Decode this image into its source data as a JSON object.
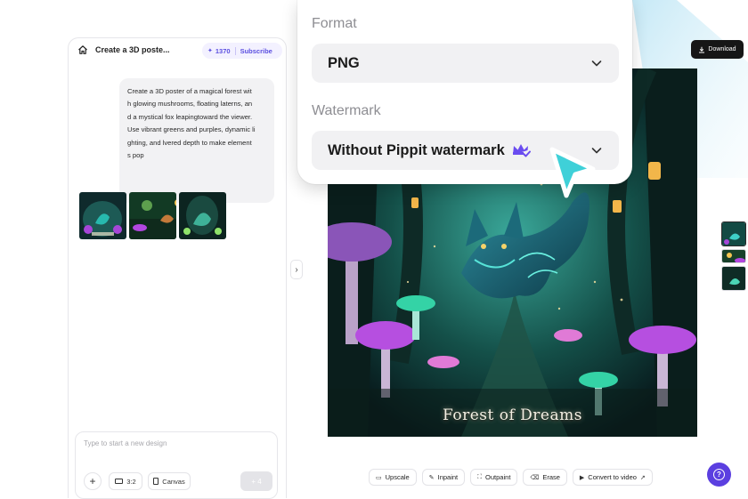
{
  "chat": {
    "title": "Create a 3D poste...",
    "credits": "1370",
    "subscribe": "Subscribe",
    "prompt_lines": [
      "Create a 3D poster of a magical forest wit",
      "h glowing mushrooms, floating laterns, an",
      "d a mystical fox leapingtoward the viewer.",
      "Use vibrant greens and purples, dynamic li",
      "ghting, and lvered depth to make element",
      "s pop"
    ],
    "input_placeholder": "Type to start a new design",
    "ratio_label": "3:2",
    "canvas_label": "Canvas",
    "send_label": "+ 4"
  },
  "canvas": {
    "download_label": "Download",
    "poster_title": "Forest of Dreams",
    "tools": [
      {
        "label": "Upscale",
        "icon": "upscale-icon",
        "glyph": "▭"
      },
      {
        "label": "Inpaint",
        "icon": "brush-icon",
        "glyph": "✎"
      },
      {
        "label": "Outpaint",
        "icon": "expand-icon",
        "glyph": "⛶"
      },
      {
        "label": "Erase",
        "icon": "eraser-icon",
        "glyph": "⌫"
      },
      {
        "label": "Convert to video",
        "icon": "video-icon",
        "glyph": "▶",
        "suffix": "↗"
      }
    ]
  },
  "export_popup": {
    "format_label": "Format",
    "format_value": "PNG",
    "watermark_label": "Watermark",
    "watermark_value": "Without Pippit watermark"
  },
  "colors": {
    "accent": "#5b3fe0",
    "crown": "#6a4cf0",
    "cursor": "#3fd0d8",
    "download_bg": "#161616"
  }
}
